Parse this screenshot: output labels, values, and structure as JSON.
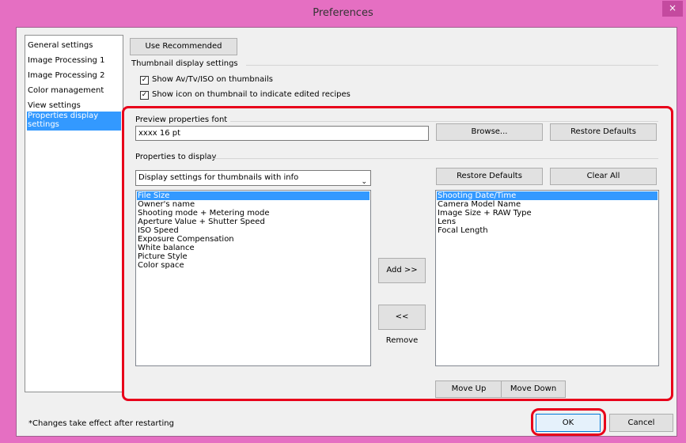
{
  "window": {
    "title": "Preferences",
    "close_glyph": "×",
    "bg_color": "#e56fc2",
    "highlight_color": "#e8001a"
  },
  "sidebar": {
    "items": [
      {
        "label": "General settings"
      },
      {
        "label": "Image Processing 1"
      },
      {
        "label": "Image Processing 2"
      },
      {
        "label": "Color management"
      },
      {
        "label": "View settings"
      },
      {
        "label": "Properties display settings",
        "selected": true
      }
    ]
  },
  "use_recommended_label": "Use Recommended",
  "thumbnail": {
    "group_label": "Thumbnail display settings",
    "show_av_tv_iso": {
      "label": "Show Av/Tv/ISO on thumbnails",
      "checked": true
    },
    "show_icon_edited": {
      "label": "Show icon on thumbnail to indicate edited recipes",
      "checked": true
    }
  },
  "font_section": {
    "label": "Preview properties font",
    "value": "xxxx 16 pt",
    "browse_label": "Browse...",
    "restore_label": "Restore Defaults"
  },
  "properties": {
    "group_label": "Properties to display",
    "dropdown_value": "Display settings for thumbnails with info",
    "available": [
      "File Size",
      "Owner's name",
      "Shooting mode + Metering mode",
      "Aperture Value + Shutter Speed",
      "ISO Speed",
      "Exposure Compensation",
      "White balance",
      "Picture Style",
      "Color space"
    ],
    "available_selected": 0,
    "displayed": [
      "Shooting Date/Time",
      "Camera Model Name",
      "Image Size + RAW Type",
      "Lens",
      "Focal Length"
    ],
    "displayed_selected": 0,
    "add_label": "Add >>",
    "remove_label": "<< Remove",
    "restore_label": "Restore Defaults",
    "clear_all_label": "Clear All",
    "move_up_label": "Move Up",
    "move_down_label": "Move Down"
  },
  "footer": {
    "note": "*Changes take effect after restarting",
    "ok_label": "OK",
    "cancel_label": "Cancel"
  }
}
